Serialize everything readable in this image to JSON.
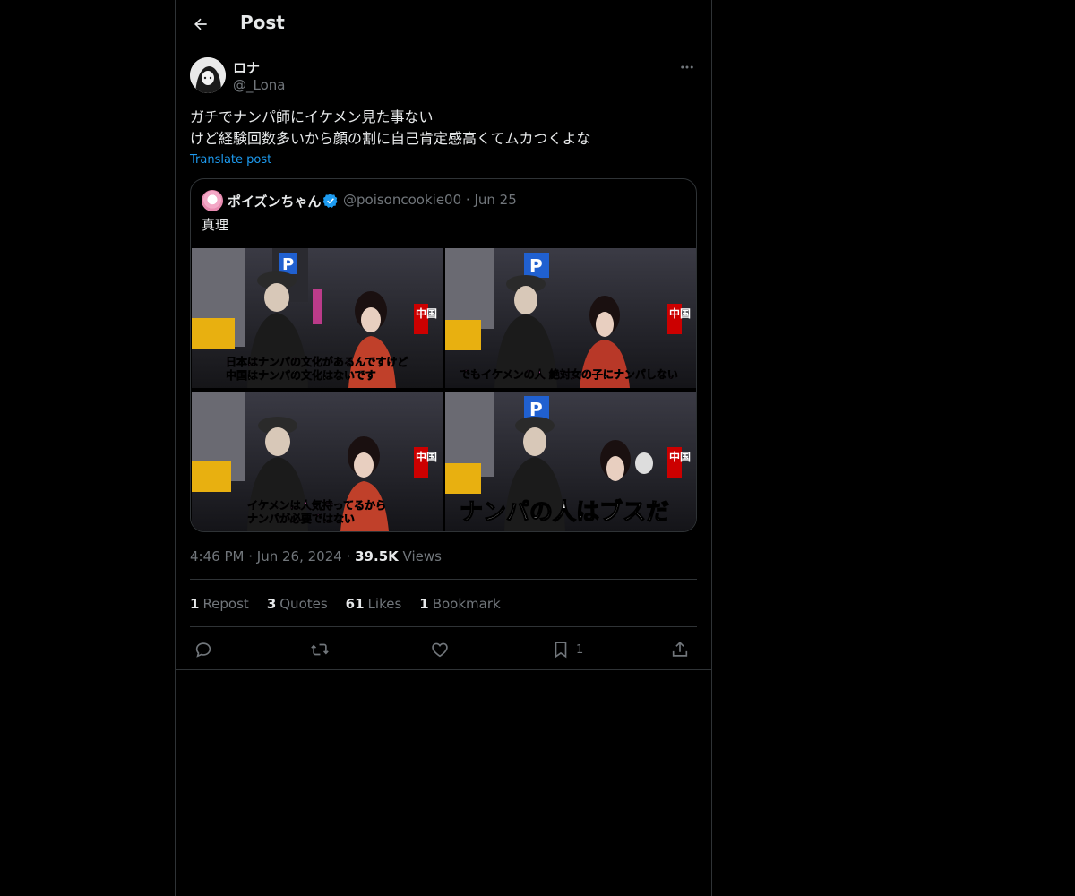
{
  "header": {
    "title": "Post"
  },
  "post": {
    "author": {
      "name": "ロナ",
      "handle": "@_Lona"
    },
    "text_line1": "ガチでナンパ師にイケメン見た事ない",
    "text_line2": "けど経験回数多いから顔の割に自己肯定感高くてムカつくよな",
    "translate_label": "Translate post",
    "quote": {
      "name": "ポイズンちゃん",
      "handle_date": "@poisoncookie00 · Jun 25",
      "text": "真理",
      "media": {
        "tile1_caption1": "日本はナンパの文化があるんですけど",
        "tile1_caption2": "中国はナンパの文化はないです",
        "tile2_caption": "でもイケメンの人 絶対女の子にナンパしない",
        "tile3_caption1": "イケメンは人気持ってるから",
        "tile3_caption2": "ナンパが必要ではない",
        "tile4_caption": "ナンパの人はブスだ",
        "corner_label": "中国"
      }
    },
    "meta": {
      "time": "4:46 PM",
      "date": "Jun 26, 2024",
      "views_count": "39.5K",
      "views_label": "Views"
    },
    "stats": {
      "reposts_count": "1",
      "reposts_label": "Repost",
      "quotes_count": "3",
      "quotes_label": "Quotes",
      "likes_count": "61",
      "likes_label": "Likes",
      "bookmarks_count": "1",
      "bookmarks_label": "Bookmark"
    },
    "actions": {
      "bookmark_count": "1"
    }
  },
  "colors": {
    "background": "#000000",
    "border": "#2f3336",
    "text": "#e7e9ea",
    "muted": "#71767b",
    "link": "#1d9bf0",
    "verified": "#1d9bf0"
  },
  "icons": [
    "back-arrow-icon",
    "more-icon",
    "verified-badge-icon",
    "reply-icon",
    "repost-icon",
    "like-icon",
    "bookmark-icon",
    "share-icon"
  ]
}
